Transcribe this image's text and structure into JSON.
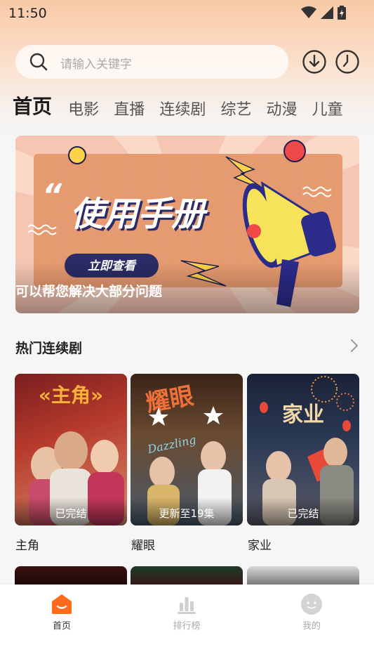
{
  "status": {
    "time": "11:50"
  },
  "search": {
    "placeholder": "请输入关键字"
  },
  "tabs": [
    {
      "label": "首页",
      "active": true
    },
    {
      "label": "电影"
    },
    {
      "label": "直播"
    },
    {
      "label": "连续剧"
    },
    {
      "label": "综艺"
    },
    {
      "label": "动漫"
    },
    {
      "label": "儿童"
    }
  ],
  "banner": {
    "title": "使用手册",
    "button": "立即查看",
    "caption": "可以帮您解决大部分问题"
  },
  "section": {
    "title": "热门连续剧"
  },
  "cards": [
    {
      "title": "主角",
      "badge": "已完结",
      "poster_text": "«主角»"
    },
    {
      "title": "耀眼",
      "badge": "更新至19集",
      "poster_text": "耀眼",
      "poster_subtext": "Dazzling"
    },
    {
      "title": "家业",
      "badge": "已完结",
      "poster_text": "家业"
    }
  ],
  "nav": [
    {
      "label": "首页",
      "icon": "home-icon",
      "active": true
    },
    {
      "label": "排行榜",
      "icon": "ranking-icon"
    },
    {
      "label": "我的",
      "icon": "profile-icon"
    }
  ],
  "colors": {
    "accent": "#ff6a1a",
    "banner_bg": "#f3b9a2"
  }
}
